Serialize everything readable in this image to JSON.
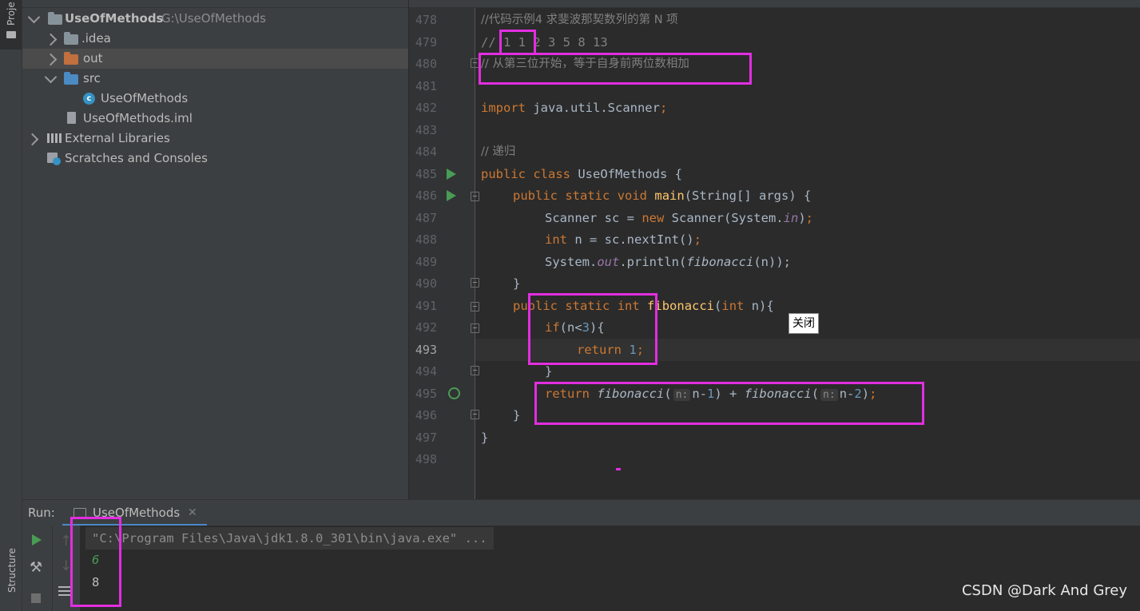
{
  "sidebar": {
    "project_tab_label": "Proje",
    "structure_tab_label": "Structure"
  },
  "project_tree": {
    "root_name": "UseOfMethods",
    "root_path": "G:\\UseOfMethods",
    "items": [
      {
        "label": ".idea"
      },
      {
        "label": "out"
      },
      {
        "label": "src"
      },
      {
        "label": "UseOfMethods"
      },
      {
        "label": "UseOfMethods.iml"
      },
      {
        "label": "External Libraries"
      },
      {
        "label": "Scratches and Consoles"
      }
    ]
  },
  "editor": {
    "line_numbers": [
      "478",
      "479",
      "480",
      "481",
      "482",
      "483",
      "484",
      "485",
      "486",
      "487",
      "488",
      "489",
      "490",
      "491",
      "492",
      "493",
      "494",
      "495",
      "496",
      "497",
      "498"
    ],
    "current_line": "493",
    "comments": {
      "line478": "//代码示例4 求斐波那契数列的第 N 项",
      "line479_prefix": "// ",
      "line479_boxed": "1 1",
      "line479_rest": " 2 3 5 8 13",
      "line480": "// 从第三位开始，等于自身前两位数相加",
      "line484": "// 递归"
    },
    "tokens": {
      "import": "import",
      "import_path": " java.util.Scanner",
      "semicolon": ";",
      "public": "public",
      "class": "class",
      "static": "static",
      "void": "void",
      "int": "int",
      "new": "new",
      "if": "if",
      "return": "return",
      "class_name": " UseOfMethods {",
      "main": "main",
      "main_params": "(String[] args) {",
      "scanner_decl": "Scanner sc = ",
      "scanner_ctor": " Scanner(System.",
      "in_field": "in",
      "close_paren": ")",
      "int_decl": " n = sc.nextInt()",
      "println_start": "System.",
      "out_field": "out",
      "println_mid": ".println(",
      "fib": "fibonacci",
      "println_end": "(n));",
      "fib_params_open": "(",
      "fib_params_close": " n){",
      "if_cond_open": "(n<",
      "three": "3",
      "if_cond_close": "){",
      "one": "1",
      "brace_close": "}",
      "param_hint": "n:",
      "n_minus": "n-",
      "two": "2",
      "plus": " + ",
      "end_paren_semicolon": ");",
      "space": " "
    },
    "tooltip": "关闭"
  },
  "run_panel": {
    "label": "Run:",
    "tab_label": "UseOfMethods",
    "command_line": "\"C:\\Program Files\\Java\\jdk1.8.0_301\\bin\\java.exe\" ...",
    "output_input": "6",
    "output_result": "8"
  },
  "watermark": "CSDN @Dark And Grey",
  "colors": {
    "highlight_box": "#e22ee0",
    "keyword": "#cc7832",
    "comment": "#808080",
    "number": "#6897bb",
    "function": "#ffc66d",
    "run_green": "#499c54"
  }
}
